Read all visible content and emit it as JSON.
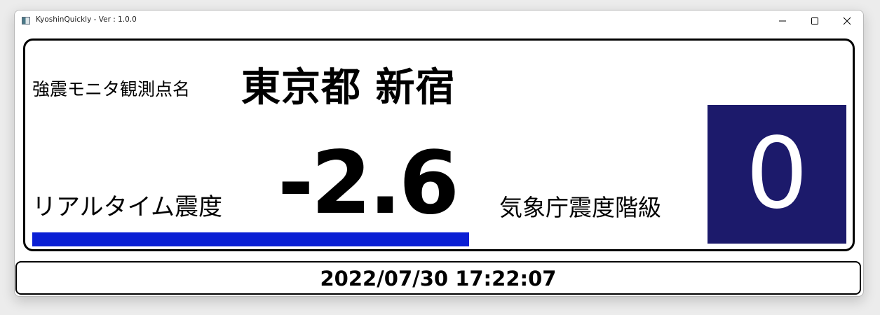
{
  "window": {
    "title": "KyoshinQuickly - Ver : 1.0.0",
    "icon": "app-window-icon",
    "controls": {
      "minimize_icon": "minimize-icon",
      "maximize_icon": "maximize-icon",
      "close_icon": "close-icon"
    }
  },
  "station": {
    "label": "強震モニタ観測点名",
    "name": "東京都 新宿"
  },
  "realtime": {
    "label": "リアルタイム震度",
    "value": "-2.6",
    "bar_fraction": 0.999,
    "bar_color": "#0a1fd4"
  },
  "jma": {
    "label": "気象庁震度階級",
    "value": "0",
    "box_color": "#1c1a6b"
  },
  "footer": {
    "timestamp": "2022/07/30 17:22:07"
  }
}
